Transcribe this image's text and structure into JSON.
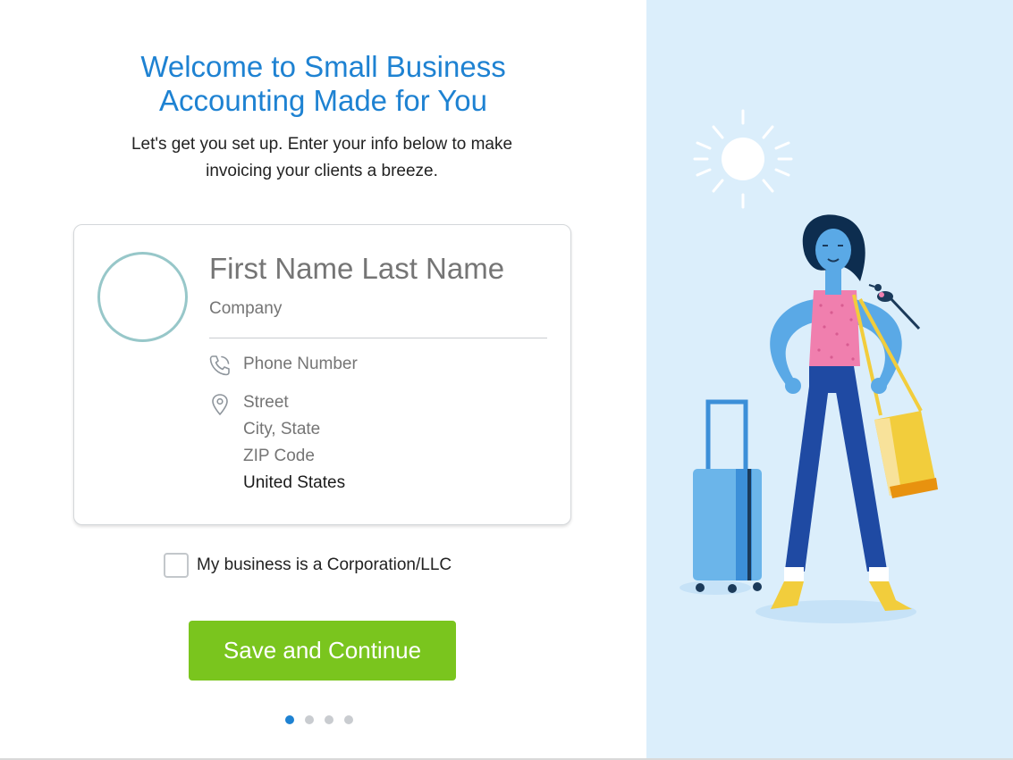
{
  "header": {
    "title_line1": "Welcome to Small Business",
    "title_line2": "Accounting Made for You",
    "subtitle_line1": "Let's get you set up. Enter your info below to make",
    "subtitle_line2": "invoicing your clients a breeze."
  },
  "card": {
    "name_placeholder": "First Name Last Name",
    "company_placeholder": "Company",
    "phone_placeholder": "Phone Number",
    "street_placeholder": "Street",
    "city_placeholder": "City, State",
    "zip_placeholder": "ZIP Code",
    "country": "United States"
  },
  "options": {
    "corporation_label": "My business is a Corporation/LLC",
    "corporation_checked": false
  },
  "actions": {
    "save_label": "Save and Continue"
  },
  "pagination": {
    "total": 4,
    "current": 1
  },
  "colors": {
    "accent": "#1e82d2",
    "button": "#7ac51e",
    "illustration_bg": "#dbeefb"
  },
  "icons": {
    "phone": "phone-icon",
    "location": "location-pin-icon"
  }
}
